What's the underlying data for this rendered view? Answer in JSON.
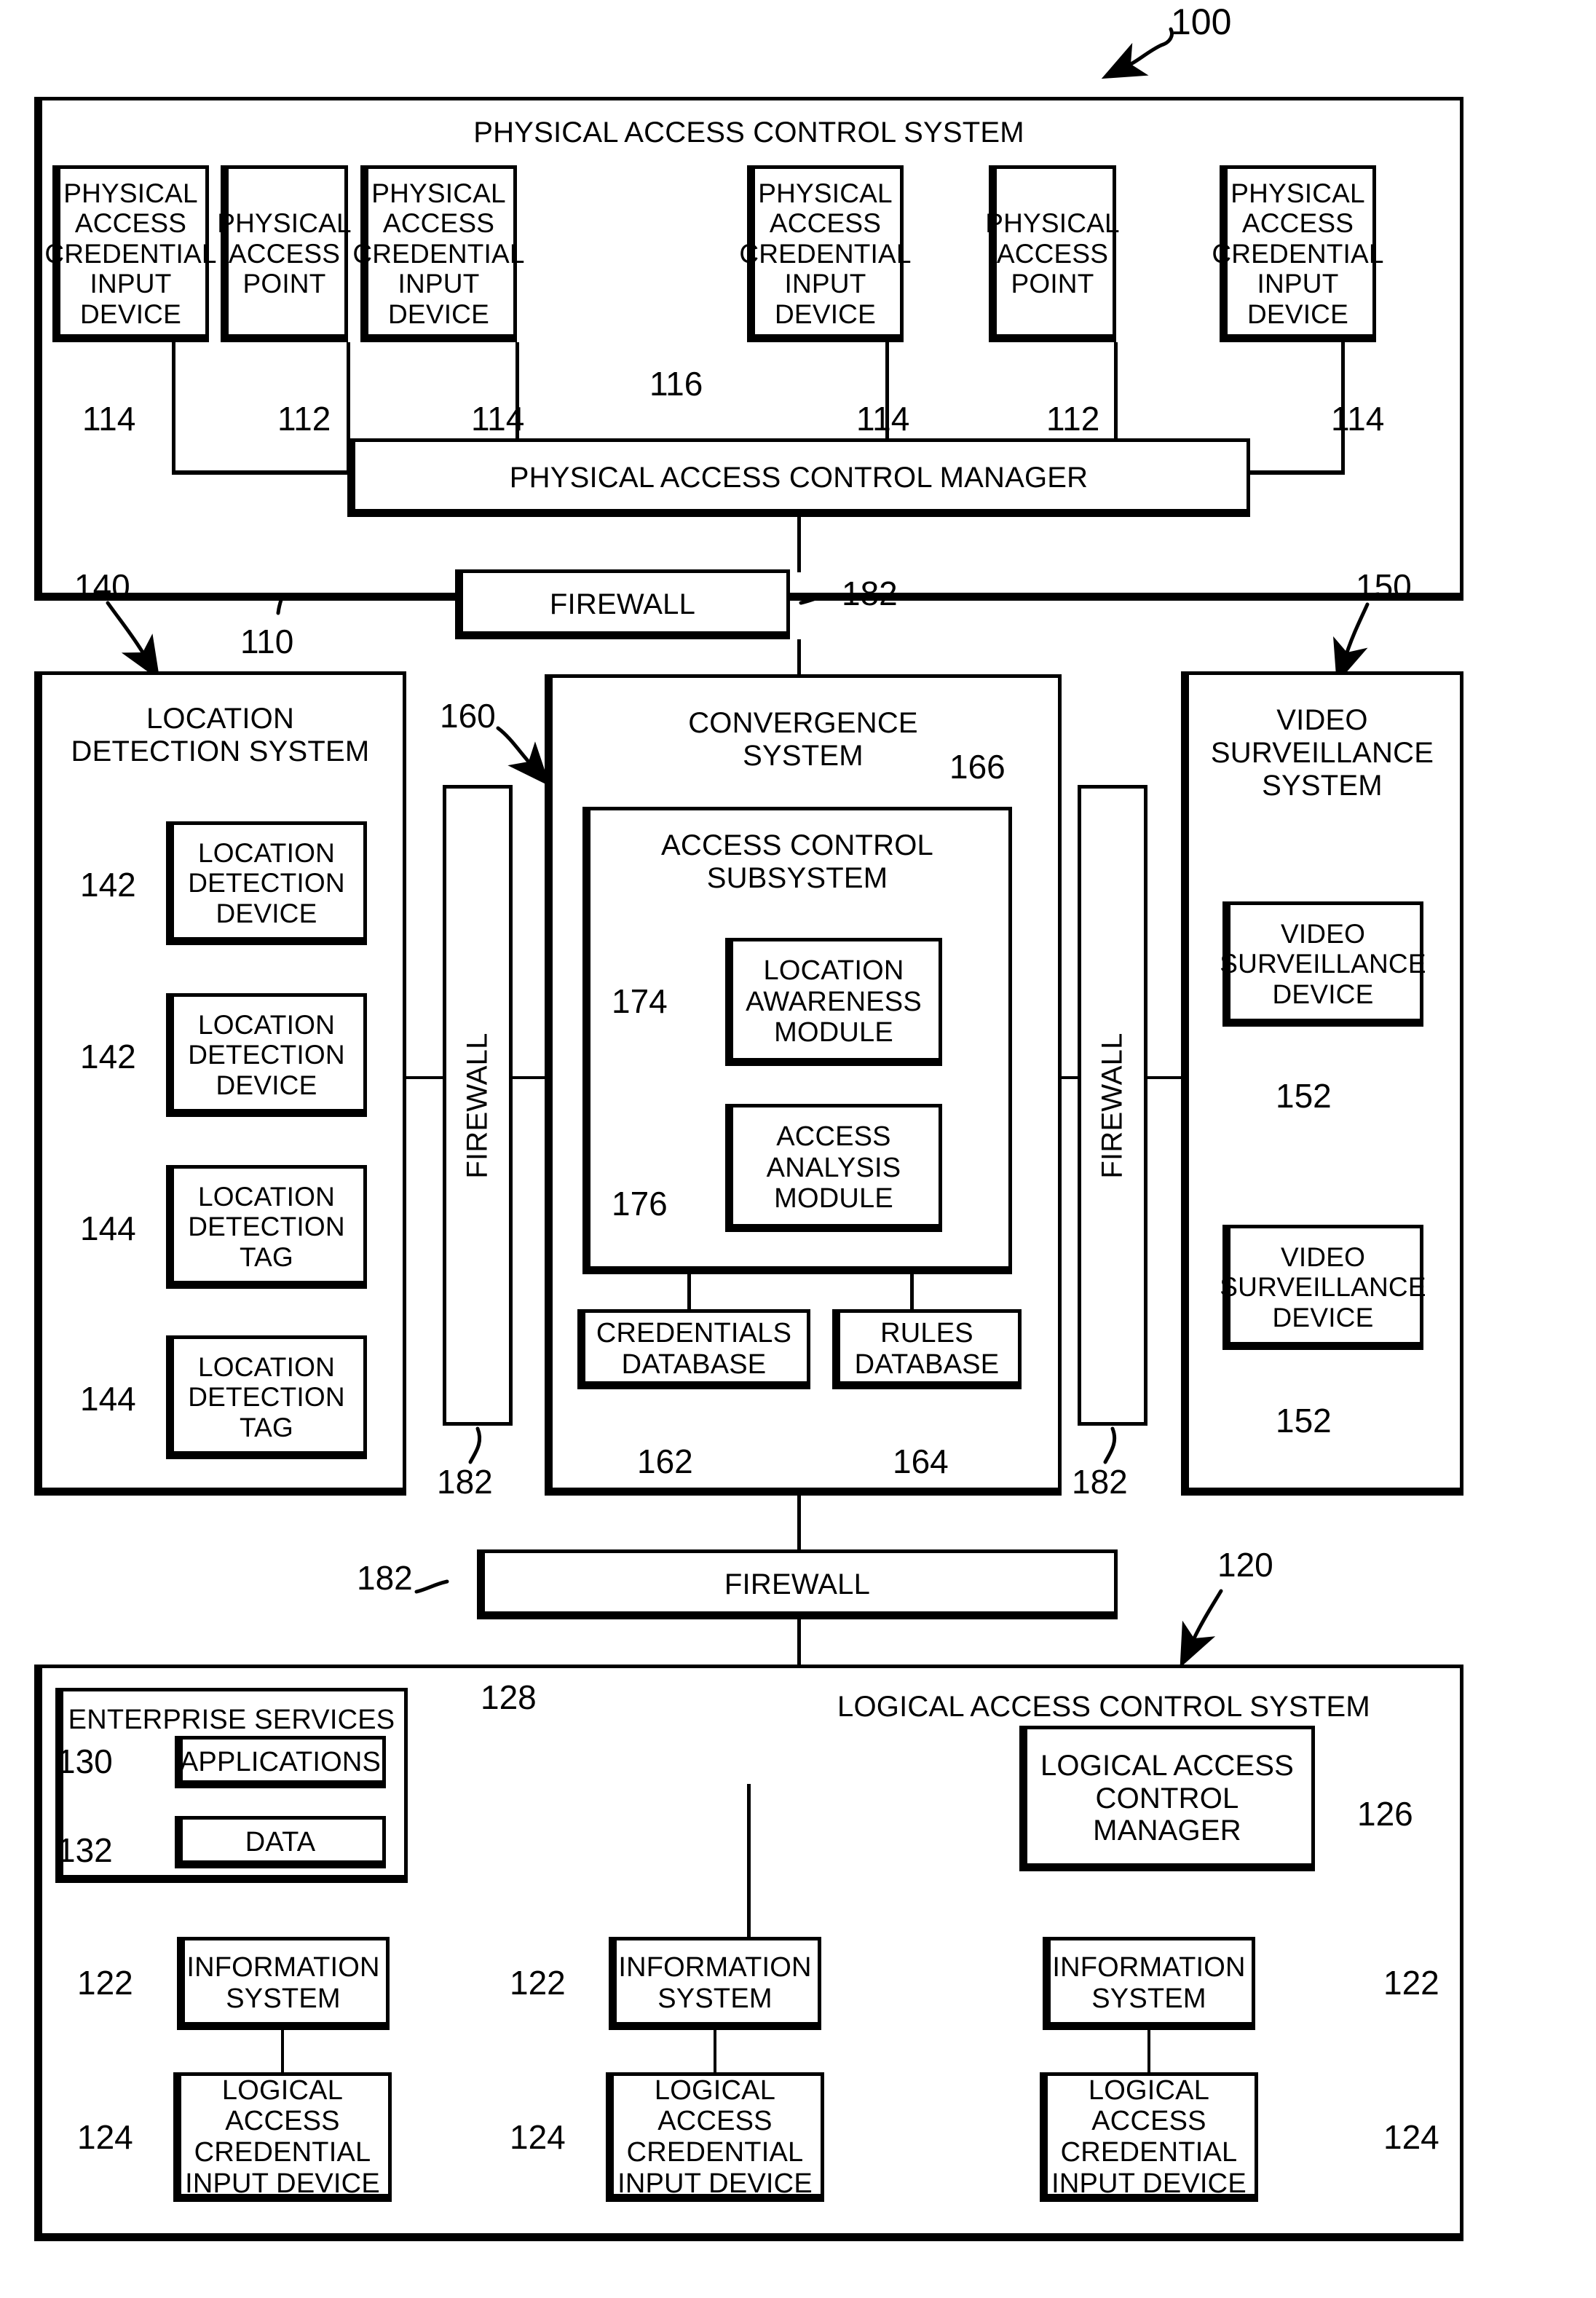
{
  "figure": {
    "ref_100": "100",
    "ref_110": "110",
    "ref_112a": "112",
    "ref_112b": "112",
    "ref_114a": "114",
    "ref_114b": "114",
    "ref_114c": "114",
    "ref_114d": "114",
    "ref_116": "116",
    "ref_120": "120",
    "ref_122a": "122",
    "ref_122b": "122",
    "ref_122c": "122",
    "ref_124a": "124",
    "ref_124b": "124",
    "ref_124c": "124",
    "ref_126": "126",
    "ref_128": "128",
    "ref_130": "130",
    "ref_132": "132",
    "ref_140": "140",
    "ref_142a": "142",
    "ref_142b": "142",
    "ref_144a": "144",
    "ref_144b": "144",
    "ref_150": "150",
    "ref_152a": "152",
    "ref_152b": "152",
    "ref_160": "160",
    "ref_162": "162",
    "ref_164": "164",
    "ref_166": "166",
    "ref_174": "174",
    "ref_176": "176",
    "ref_182a": "182",
    "ref_182b": "182",
    "ref_182c": "182",
    "ref_182d": "182"
  },
  "pacs": {
    "title": "PHYSICAL ACCESS CONTROL SYSTEM",
    "manager": "PHYSICAL ACCESS CONTROL MANAGER",
    "devices": [
      {
        "label": "PHYSICAL\nACCESS\nCREDENTIAL\nINPUT DEVICE",
        "ref": "114"
      },
      {
        "label": "PHYSICAL\nACCESS\nPOINT",
        "ref": "112"
      },
      {
        "label": "PHYSICAL\nACCESS\nCREDENTIAL\nINPUT DEVICE",
        "ref": "114"
      },
      {
        "label": "PHYSICAL\nACCESS\nCREDENTIAL\nINPUT DEVICE",
        "ref": "114"
      },
      {
        "label": "PHYSICAL\nACCESS\nPOINT",
        "ref": "112"
      },
      {
        "label": "PHYSICAL\nACCESS\nCREDENTIAL\nINPUT DEVICE",
        "ref": "114"
      }
    ]
  },
  "firewalls": {
    "top": "FIREWALL",
    "left": "FIREWALL",
    "right": "FIREWALL",
    "bottom": "FIREWALL"
  },
  "lds": {
    "title": "LOCATION\nDETECTION SYSTEM",
    "items": [
      {
        "label": "LOCATION\nDETECTION\nDEVICE",
        "ref": "142"
      },
      {
        "label": "LOCATION\nDETECTION\nDEVICE",
        "ref": "142"
      },
      {
        "label": "LOCATION\nDETECTION\nTAG",
        "ref": "144"
      },
      {
        "label": "LOCATION\nDETECTION\nTAG",
        "ref": "144"
      }
    ]
  },
  "convergence": {
    "title": "CONVERGENCE\nSYSTEM",
    "subsystem_title": "ACCESS CONTROL\nSUBSYSTEM",
    "modules": [
      {
        "label": "LOCATION\nAWARENESS\nMODULE",
        "ref": "174"
      },
      {
        "label": "ACCESS\nANALYSIS\nMODULE",
        "ref": "176"
      }
    ],
    "databases": [
      {
        "label": "CREDENTIALS\nDATABASE",
        "ref": "162"
      },
      {
        "label": "RULES\nDATABASE",
        "ref": "164"
      }
    ]
  },
  "vss": {
    "title": "VIDEO\nSURVEILLANCE\nSYSTEM",
    "devices": [
      {
        "label": "VIDEO\nSURVEILLANCE\nDEVICE",
        "ref": "152"
      },
      {
        "label": "VIDEO\nSURVEILLANCE\nDEVICE",
        "ref": "152"
      }
    ]
  },
  "lacs": {
    "title": "LOGICAL ACCESS CONTROL SYSTEM",
    "manager": "LOGICAL ACCESS\nCONTROL\nMANAGER",
    "enterprise": {
      "title": "ENTERPRISE SERVICES",
      "applications": "APPLICATIONS",
      "data": "DATA"
    },
    "information_systems": [
      {
        "label": "INFORMATION\nSYSTEM",
        "ref": "122"
      },
      {
        "label": "INFORMATION\nSYSTEM",
        "ref": "122"
      },
      {
        "label": "INFORMATION\nSYSTEM",
        "ref": "122"
      }
    ],
    "credential_devices": [
      {
        "label": "LOGICAL ACCESS\nCREDENTIAL\nINPUT DEVICE",
        "ref": "124"
      },
      {
        "label": "LOGICAL ACCESS\nCREDENTIAL\nINPUT DEVICE",
        "ref": "124"
      },
      {
        "label": "LOGICAL ACCESS\nCREDENTIAL\nINPUT DEVICE",
        "ref": "124"
      }
    ]
  }
}
